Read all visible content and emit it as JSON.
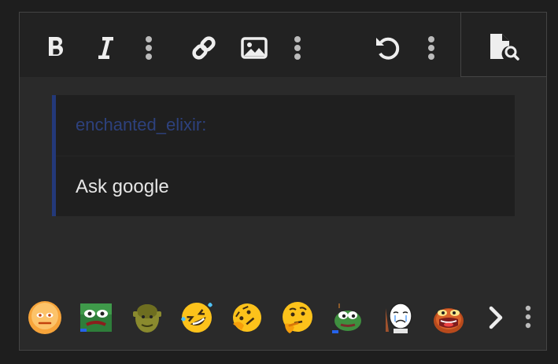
{
  "toolbar": {
    "buttons": [
      {
        "name": "bold-button",
        "icon": "bold-icon"
      },
      {
        "name": "italic-button",
        "icon": "italic-icon"
      },
      {
        "name": "more-format-button",
        "icon": "more-vertical-icon"
      },
      {
        "name": "link-button",
        "icon": "link-icon"
      },
      {
        "name": "image-button",
        "icon": "image-icon"
      },
      {
        "name": "more-insert-button",
        "icon": "more-vertical-icon"
      },
      {
        "name": "undo-button",
        "icon": "undo-icon"
      },
      {
        "name": "more-options-button",
        "icon": "more-vertical-icon"
      }
    ],
    "preview": {
      "icon": "file-search-icon"
    }
  },
  "quote": {
    "author": "enchanted_elixir:",
    "text": "Ask google"
  },
  "emoji_bar": {
    "items": [
      "neutral-face-emoji",
      "sad-frog-emoji",
      "ogre-face-emoji",
      "rolling-laughing-emoji",
      "thinking-tilted-emoji",
      "thinking-face-emoji",
      "pepe-frog-emoji",
      "crying-meme-emoji",
      "angry-frog-emoji"
    ],
    "next_icon": "chevron-right-icon",
    "more_icon": "more-vertical-icon"
  },
  "colors": {
    "background": "#1e1e1e",
    "toolbar": "#222222",
    "editor": "#2a2a2a",
    "quote_bg": "#1f1f1f",
    "quote_border": "#23397a",
    "author": "#2d417d",
    "text": "#e6e6e6",
    "icons": "#eeeeee"
  }
}
